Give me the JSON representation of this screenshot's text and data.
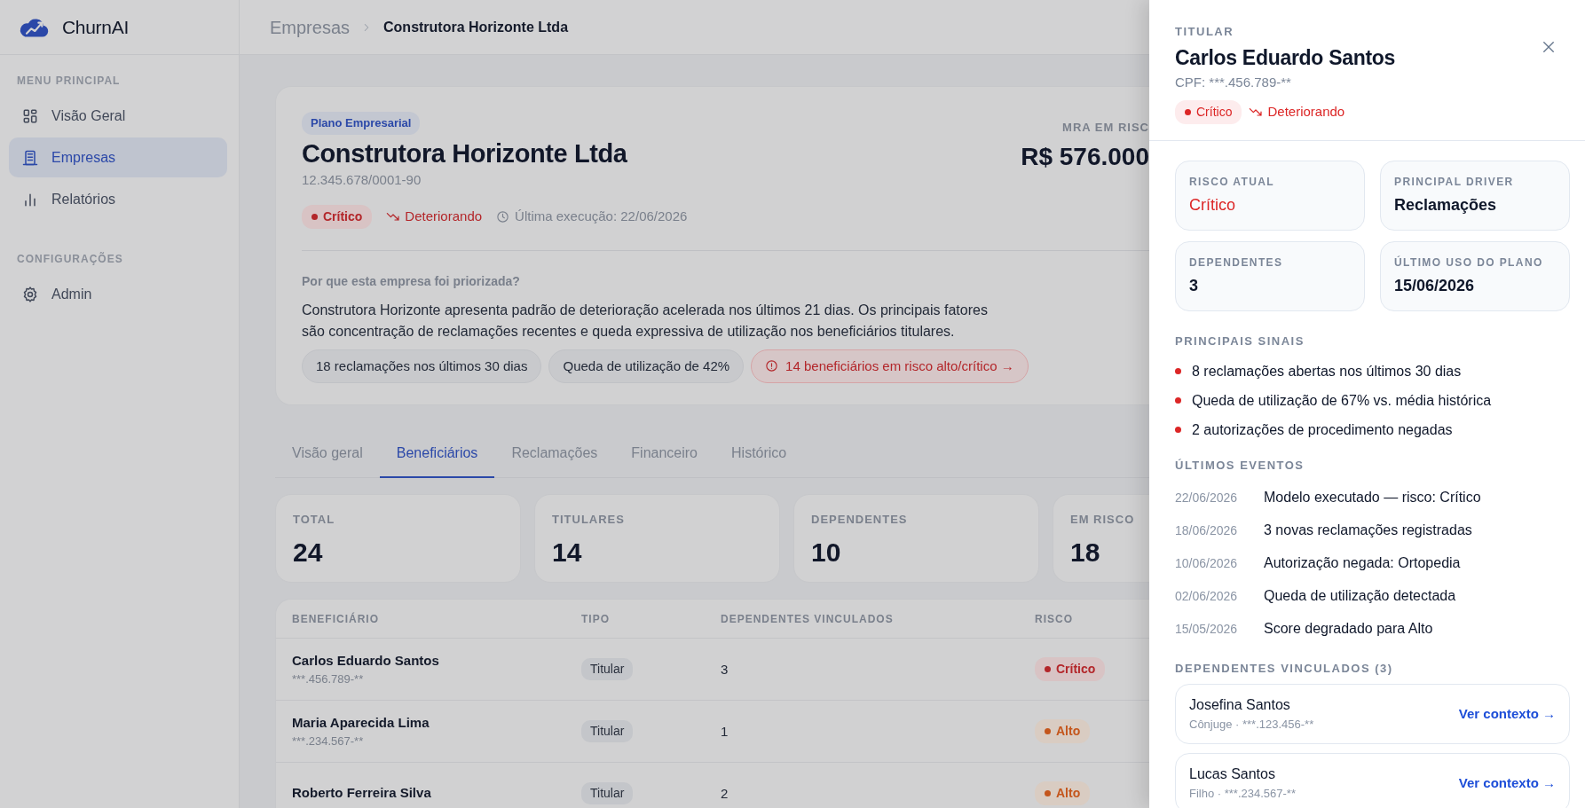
{
  "sidebar": {
    "brand": "ChurnAI",
    "sections": [
      {
        "title": "MENU PRINCIPAL",
        "items": [
          {
            "label": "Visão Geral",
            "selected": false
          },
          {
            "label": "Empresas",
            "selected": true
          },
          {
            "label": "Relatórios",
            "selected": false
          }
        ]
      },
      {
        "title": "CONFIGURAÇÕES",
        "items": [
          {
            "label": "Admin",
            "selected": false
          }
        ]
      }
    ]
  },
  "breadcrumb": {
    "parent": "Empresas",
    "current": "Construtora Horizonte Ltda"
  },
  "company": {
    "plan_badge": "Plano Empresarial",
    "name": "Construtora Horizonte Ltda",
    "cnpj": "12.345.678/0001-90",
    "risk": {
      "label": "Crítico",
      "kind": "critical"
    },
    "trend": "Deteriorando",
    "last_run": "Última execução: 22/06/2026",
    "mra_label": "MRA EM RISC",
    "mra_value": "R$ 576.000",
    "question": "Por que esta empresa foi priorizada?",
    "explanation": "Construtora Horizonte apresenta padrão de deterioração acelerada nos últimos 21 dias. Os principais fatores são concentração de reclamações recentes e queda expressiva de utilização nos beneficiários titulares.",
    "chips": [
      {
        "label": "18 reclamações nos últimos 30 dias",
        "kind": "neutral"
      },
      {
        "label": "Queda de utilização de 42%",
        "kind": "neutral"
      },
      {
        "label": "14 beneficiários em risco alto/crítico →",
        "kind": "alert"
      }
    ]
  },
  "tabs": [
    {
      "label": "Visão geral",
      "selected": false
    },
    {
      "label": "Beneficiários",
      "selected": true
    },
    {
      "label": "Reclamações",
      "selected": false
    },
    {
      "label": "Financeiro",
      "selected": false
    },
    {
      "label": "Histórico",
      "selected": false
    }
  ],
  "stats": [
    {
      "label": "TOTAL",
      "value": "24"
    },
    {
      "label": "TITULARES",
      "value": "14"
    },
    {
      "label": "DEPENDENTES",
      "value": "10"
    },
    {
      "label": "EM RISCO",
      "value": "18"
    }
  ],
  "table": {
    "columns": [
      "BENEFICIÁRIO",
      "TIPO",
      "DEPENDENTES VINCULADOS",
      "RISCO"
    ],
    "rows": [
      {
        "name": "Carlos Eduardo Santos",
        "cpf": "***.456.789-**",
        "type": "Titular",
        "dependents": "3",
        "risk": {
          "label": "Crítico",
          "kind": "critical"
        }
      },
      {
        "name": "Maria Aparecida Lima",
        "cpf": "***.234.567-**",
        "type": "Titular",
        "dependents": "1",
        "risk": {
          "label": "Alto",
          "kind": "high"
        }
      },
      {
        "name": "Roberto Ferreira Silva",
        "type": "Titular",
        "dependents": "2",
        "risk": {
          "label": "Alto",
          "kind": "high"
        }
      }
    ]
  },
  "drawer": {
    "eyebrow": "TITULAR",
    "name": "Carlos Eduardo Santos",
    "cpf": "CPF: ***.456.789-**",
    "risk": {
      "label": "Crítico",
      "kind": "critical"
    },
    "trend": "Deteriorando",
    "info": [
      {
        "label": "RISCO ATUAL",
        "value": "Crítico",
        "kind": "critical"
      },
      {
        "label": "PRINCIPAL DRIVER",
        "value": "Reclamações",
        "kind": "normal"
      },
      {
        "label": "DEPENDENTES",
        "value": "3",
        "kind": "normal"
      },
      {
        "label": "ÚLTIMO USO DO PLANO",
        "value": "15/06/2026",
        "kind": "normal"
      }
    ],
    "signals_title": "PRINCIPAIS SINAIS",
    "signals": [
      "8 reclamações abertas nos últimos 30 dias",
      "Queda de utilização de 67% vs. média histórica",
      "2 autorizações de procedimento negadas"
    ],
    "events_title": "ÚLTIMOS EVENTOS",
    "events": [
      {
        "date": "22/06/2026",
        "text": "Modelo executado — risco: Crítico"
      },
      {
        "date": "18/06/2026",
        "text": "3 novas reclamações registradas"
      },
      {
        "date": "10/06/2026",
        "text": "Autorização negada: Ortopedia"
      },
      {
        "date": "02/06/2026",
        "text": "Queda de utilização detectada"
      },
      {
        "date": "15/05/2026",
        "text": "Score degradado para Alto"
      }
    ],
    "dependents_title": "DEPENDENTES VINCULADOS (3)",
    "dependents": [
      {
        "name": "Josefina Santos",
        "meta": "Cônjuge · ***.123.456-**",
        "link": "Ver contexto →"
      },
      {
        "name": "Lucas Santos",
        "meta": "Filho · ***.234.567-**",
        "link": "Ver contexto →"
      }
    ]
  }
}
